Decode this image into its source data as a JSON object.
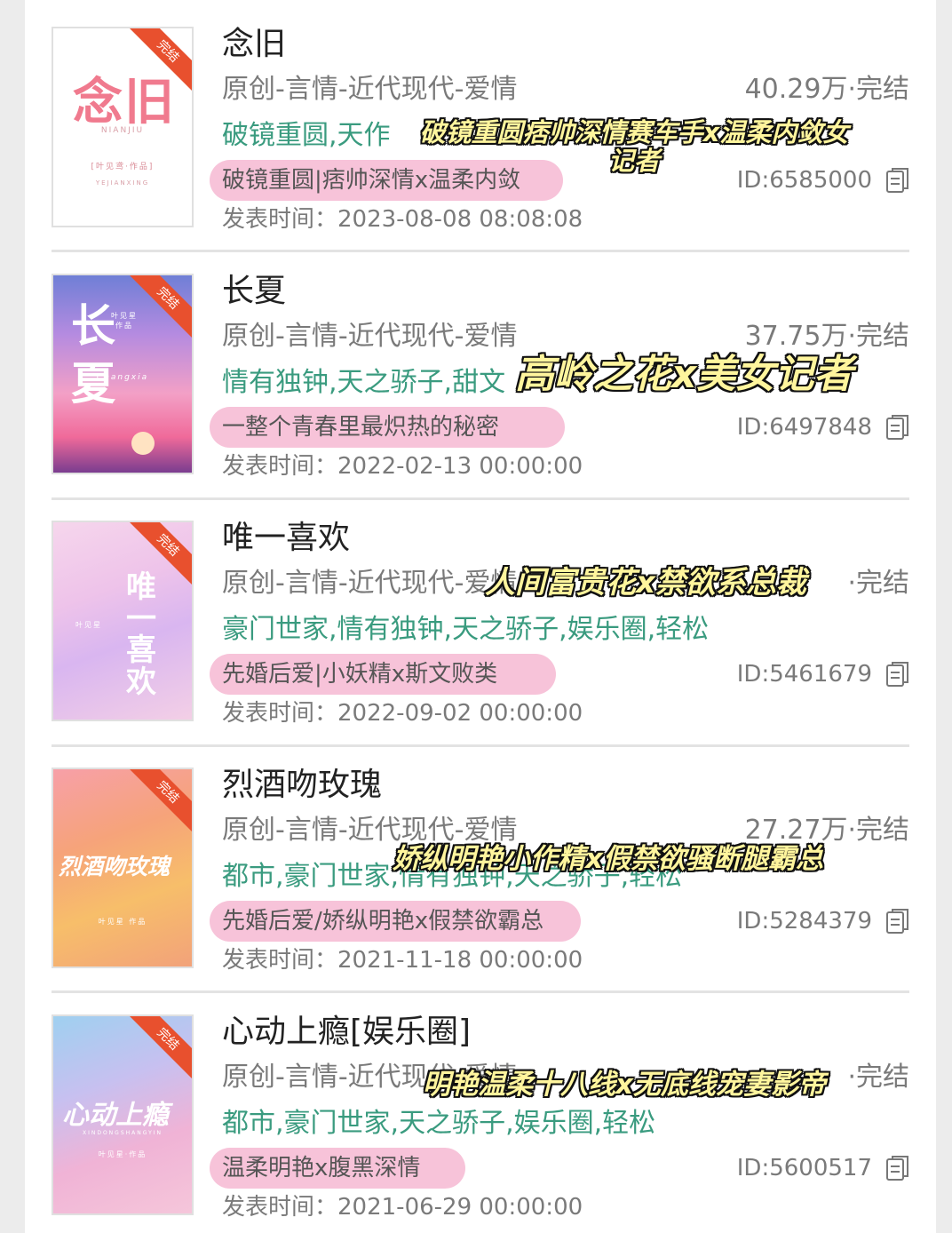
{
  "labels": {
    "time_prefix": "发表时间："
  },
  "books": [
    {
      "title": "念旧",
      "category": "原创-言情-近代现代-爱情",
      "count_status": "40.29万·完结",
      "tags": "破镜重圆,天作",
      "intro": "破镜重圆|痞帅深情x温柔内敛",
      "id": "ID:6585000",
      "published": "2023-08-08 08:08:08",
      "cover": {
        "title": "念旧",
        "pinyin": "NIANJIU",
        "byline": "[叶见鸢·作品]",
        "author_pinyin": "YEJIANXING",
        "ribbon": "完结"
      },
      "annotation": "破镜重圆痞帅深情赛车手x温柔内敛女记者"
    },
    {
      "title": "长夏",
      "category": "原创-言情-近代现代-爱情",
      "count_status": "37.75万·完结",
      "tags": "情有独钟,天之骄子,甜文",
      "intro": "一整个青春里最炽热的秘密",
      "id": "ID:6497848",
      "published": "2022-02-13 00:00:00",
      "cover": {
        "title": "长夏",
        "pinyin": "Changxia",
        "byline": "叶见星 作品",
        "ribbon": "完结"
      },
      "annotation": "高岭之花x美女记者"
    },
    {
      "title": "唯一喜欢",
      "category": "原创-言情-近代现代-爱情",
      "count_status": "·完结",
      "tags": "豪门世家,情有独钟,天之骄子,娱乐圈,轻松",
      "intro": "先婚后爱|小妖精x斯文败类",
      "id": "ID:5461679",
      "published": "2022-09-02 00:00:00",
      "cover": {
        "title": "唯一喜欢",
        "byline": "叶见星",
        "ribbon": "完结"
      },
      "annotation": "人间富贵花x禁欲系总裁"
    },
    {
      "title": "烈酒吻玫瑰",
      "category": "原创-言情-近代现代-爱情",
      "count_status": "27.27万·完结",
      "tags": "都市,豪门世家,情有独钟,天之骄子,轻松",
      "intro": "先婚后爱/娇纵明艳x假禁欲霸总",
      "id": "ID:5284379",
      "published": "2021-11-18 00:00:00",
      "cover": {
        "title": "烈酒吻玫瑰",
        "byline": "叶见星 作品",
        "ribbon": "完结"
      },
      "annotation": "娇纵明艳小作精x假禁欲骚断腿霸总"
    },
    {
      "title": "心动上瘾[娱乐圈]",
      "category": "原创-言情-近代现代-爱情",
      "count_status": "·完结",
      "tags": "都市,豪门世家,天之骄子,娱乐圈,轻松",
      "intro": "温柔明艳x腹黑深情",
      "id": "ID:5600517",
      "published": "2021-06-29 00:00:00",
      "cover": {
        "title": "心动上瘾",
        "pinyin": "XINDONGSHANGYIN",
        "byline": "叶见星·作品",
        "ribbon": "完结"
      },
      "annotation": "明艳温柔十八线x无底线宠妻影帝"
    }
  ],
  "colors": {
    "tag_green": "#3a9b7f",
    "highlight_pink": "#f7c3d9",
    "ribbon_orange": "#e8502e",
    "annotation_yellow": "#fff59d"
  },
  "icons": {
    "copy": "copy-icon"
  }
}
